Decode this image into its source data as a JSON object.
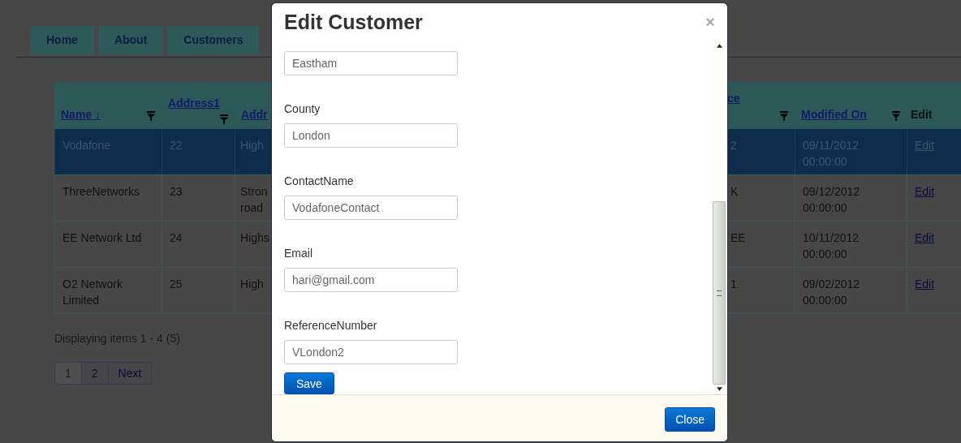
{
  "nav": {
    "tabs": [
      {
        "label": "Home"
      },
      {
        "label": "About"
      },
      {
        "label": "Customers"
      }
    ]
  },
  "table": {
    "columns": [
      {
        "label": "Name ↓",
        "filter": true
      },
      {
        "label": "Address1",
        "filter": true
      },
      {
        "label": "Addr",
        "filter": false
      },
      {
        "label": "ce",
        "filter": true
      },
      {
        "label": "Modified On",
        "filter": true
      },
      {
        "label": "Edit",
        "kind": "plain"
      }
    ],
    "rows": [
      {
        "selected": true,
        "cells": [
          "Vodafone",
          "22",
          "High",
          "2",
          "09/11/2012 00:00:00",
          "Edit"
        ]
      },
      {
        "selected": false,
        "cells": [
          "ThreeNetworks",
          "23",
          "Stron road",
          "K",
          "09/12/2012 00:00:00",
          "Edit"
        ]
      },
      {
        "selected": false,
        "cells": [
          "EE Network Ltd",
          "24",
          "Highs",
          "EE",
          "10/11/2012 00:00:00",
          "Edit"
        ]
      },
      {
        "selected": false,
        "cells": [
          "O2 Network Limited",
          "25",
          "High",
          "1",
          "09/02/2012 00:00:00",
          "Edit"
        ]
      }
    ]
  },
  "summary": "Displaying items 1 - 4 (5)",
  "pager": [
    {
      "label": "1",
      "selected": true
    },
    {
      "label": "2",
      "selected": false
    },
    {
      "label": "Next",
      "selected": false
    }
  ],
  "modal": {
    "title": "Edit Customer",
    "close_glyph": "×",
    "fields": [
      {
        "value": "Eastham"
      },
      {
        "label": "County",
        "value": "London"
      },
      {
        "label": "ContactName",
        "value": "VodafoneContact"
      },
      {
        "label": "Email",
        "value": "hari@gmail.com"
      },
      {
        "label": "ReferenceNumber",
        "value": "VLondon2"
      }
    ],
    "save": "Save",
    "close": "Close"
  }
}
